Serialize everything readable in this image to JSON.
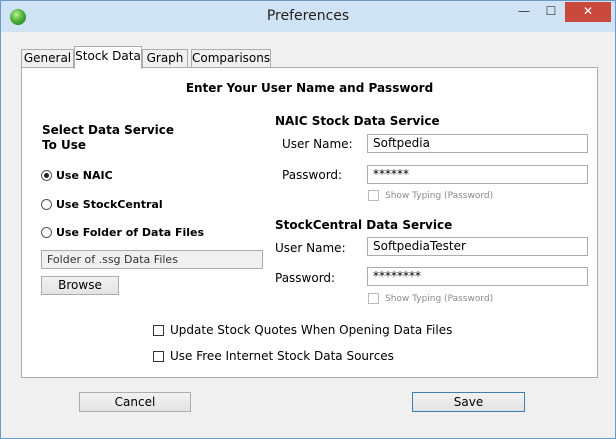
{
  "window": {
    "title": "Preferences"
  },
  "titlebar": {
    "minimize": "—",
    "maximize": "☐",
    "close": "✕"
  },
  "tabs": [
    {
      "label": "General"
    },
    {
      "label": "Stock Data",
      "active": true
    },
    {
      "label": "Graph"
    },
    {
      "label": "Comparisons"
    }
  ],
  "panel": {
    "heading": "Enter Your User Name and Password",
    "service": {
      "title_line1": "Select Data Service",
      "title_line2": "To Use",
      "options": [
        {
          "label": "Use NAIC",
          "selected": true
        },
        {
          "label": "Use StockCentral",
          "selected": false
        },
        {
          "label": "Use Folder of Data Files",
          "selected": false
        }
      ],
      "folder_field": "Folder of .ssg Data Files",
      "browse_label": "Browse"
    },
    "naic": {
      "title": "NAIC Stock Data Service",
      "username_label": "User Name:",
      "username_value": "Softpedia",
      "password_label": "Password:",
      "password_value": "******",
      "show_typing_label": "Show Typing (Password)"
    },
    "stockcentral": {
      "title": "StockCentral Data Service",
      "username_label": "User Name:",
      "username_value": "SoftpediaTester",
      "password_label": "Password:",
      "password_value": "********",
      "show_typing_label": "Show Typing (Password)"
    },
    "options": {
      "update_quotes": "Update Stock Quotes When Opening Data Files",
      "free_sources": "Use Free Internet Stock Data Sources"
    }
  },
  "footer": {
    "cancel_label": "Cancel",
    "save_label": "Save"
  }
}
